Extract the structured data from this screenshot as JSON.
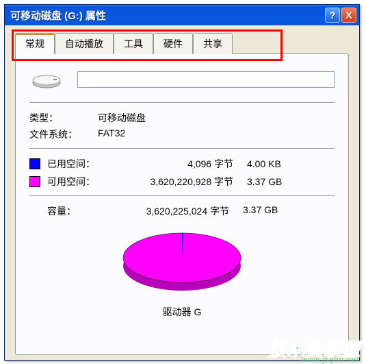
{
  "window": {
    "title": "可移动磁盘 (G:) 属性"
  },
  "tabs": [
    {
      "label": "常规"
    },
    {
      "label": "自动播放"
    },
    {
      "label": "工具"
    },
    {
      "label": "硬件"
    },
    {
      "label": "共享"
    }
  ],
  "volume_label": "",
  "type": {
    "label": "类型：",
    "value": "可移动磁盘"
  },
  "filesystem": {
    "label": "文件系统：",
    "value": "FAT32"
  },
  "used": {
    "label": "已用空间：",
    "bytes": "4,096 字节",
    "human": "4.00 KB",
    "color": "#0000FF"
  },
  "free": {
    "label": "可用空间：",
    "bytes": "3,620,220,928 字节",
    "human": "3.37 GB",
    "color": "#FF00FF"
  },
  "capacity": {
    "label": "容量：",
    "bytes": "3,620,225,024 字节",
    "human": "3.37 GB"
  },
  "pie_label": "驱动器 G",
  "icons": {
    "help": "?",
    "close": "X"
  },
  "watermark": {
    "text": "技术员联盟",
    "url": "www.jsgho.net"
  },
  "chart_data": {
    "type": "pie",
    "title": "驱动器 G",
    "series": [
      {
        "name": "已用空间",
        "value": 4096,
        "color": "#0000FF"
      },
      {
        "name": "可用空间",
        "value": 3620220928,
        "color": "#FF00FF"
      }
    ]
  }
}
